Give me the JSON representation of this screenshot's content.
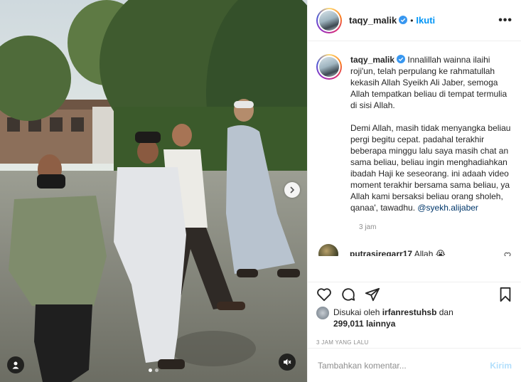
{
  "post": {
    "author": "taqy_malik",
    "follow_label": "Ikuti",
    "separator": "•",
    "more_label": "•••"
  },
  "caption": {
    "author": "taqy_malik",
    "text_part1": "Innalillah wainna ilaihi roji'un, telah perpulang ke rahmatullah kekasih Allah Syeikh Ali Jaber, semoga Allah tempatkan beliau di tempat termulia di sisi Allah.\n\nDemi Allah, masih tidak menyangka beliau pergi begitu cepat. padahal terakhir beberapa minggu lalu saya masih chat an sama beliau, beliau ingin menghadiahkan ibadah Haji ke seseorang. ini adaah video moment terakhir bersama sama beliau, ya Allah kami bersaksi beliau orang sholeh, qanaa', tawadhu. ",
    "mention": "@syekh.alijaber",
    "time": "3 jam"
  },
  "comments": [
    {
      "user": "putrasiregarr17",
      "text": "Allah 😭"
    }
  ],
  "likes": {
    "prefix": "Disukai oleh",
    "user": "irfanrestuhsb",
    "middle": "dan",
    "count": "299,011 lainnya"
  },
  "post_date": "3 JAM YANG LALU",
  "comment_box": {
    "placeholder": "Tambahkan komentar...",
    "send_label": "Kirim"
  },
  "carousel": {
    "slides": 2,
    "active": 0
  },
  "colors": {
    "accent": "#0095f6",
    "text": "#262626",
    "muted": "#8e8e8e"
  },
  "icons": [
    "verified-icon",
    "more-icon",
    "heart-icon",
    "comment-icon",
    "share-icon",
    "bookmark-icon",
    "chevron-right-icon",
    "user-tag-icon",
    "mute-icon"
  ]
}
